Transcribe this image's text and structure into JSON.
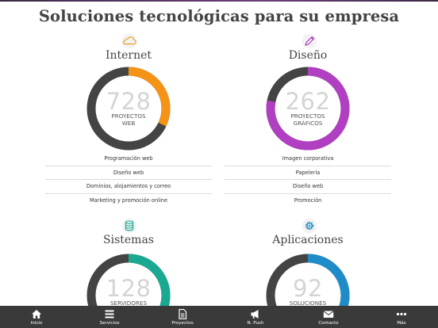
{
  "title": "Soluciones tecnológicas para su empresa",
  "colors": {
    "background": "#ffffff",
    "track": "#444444",
    "tabbar": "#3a3a3a",
    "divider": "#dcdcdc",
    "number": "#d4d4d4"
  },
  "sections": [
    {
      "id": "internet",
      "title": "Internet",
      "icon": "cloud-icon",
      "color": "#f59316",
      "number": "728",
      "caption_line1": "PROYECTOS",
      "caption_line2": "WEB",
      "progress": 0.32,
      "items": [
        "Programación web",
        "Diseño web",
        "Dominios, alojamientos y correo",
        "Marketing y promoción online"
      ]
    },
    {
      "id": "diseno",
      "title": "Diseño",
      "icon": "pencil-icon",
      "color": "#b13fc2",
      "number": "262",
      "caption_line1": "PROYECTOS",
      "caption_line2": "GRÁFICOS",
      "progress": 0.78,
      "items": [
        "Imagen corporativa",
        "Papelería",
        "Diseño web",
        "Promoción"
      ]
    },
    {
      "id": "sistemas",
      "title": "Sistemas",
      "icon": "database-icon",
      "color": "#19a990",
      "number": "128",
      "caption_line1": "SERVIDORES",
      "caption_line2": "",
      "progress": 0.4,
      "items": []
    },
    {
      "id": "aplicaciones",
      "title": "Aplicaciones",
      "icon": "gear-icon",
      "color": "#1e8cc8",
      "number": "92",
      "caption_line1": "SOLUCIONES",
      "caption_line2": "",
      "progress": 0.45,
      "items": []
    }
  ],
  "tabs": [
    {
      "label": "Inicio",
      "icon": "home-icon"
    },
    {
      "label": "Servicios",
      "icon": "menu-icon"
    },
    {
      "label": "Proyectos",
      "icon": "document-icon"
    },
    {
      "label": "N. Push",
      "icon": "megaphone-icon"
    },
    {
      "label": "Contacto",
      "icon": "envelope-icon"
    },
    {
      "label": "Más",
      "icon": "more-icon"
    }
  ]
}
